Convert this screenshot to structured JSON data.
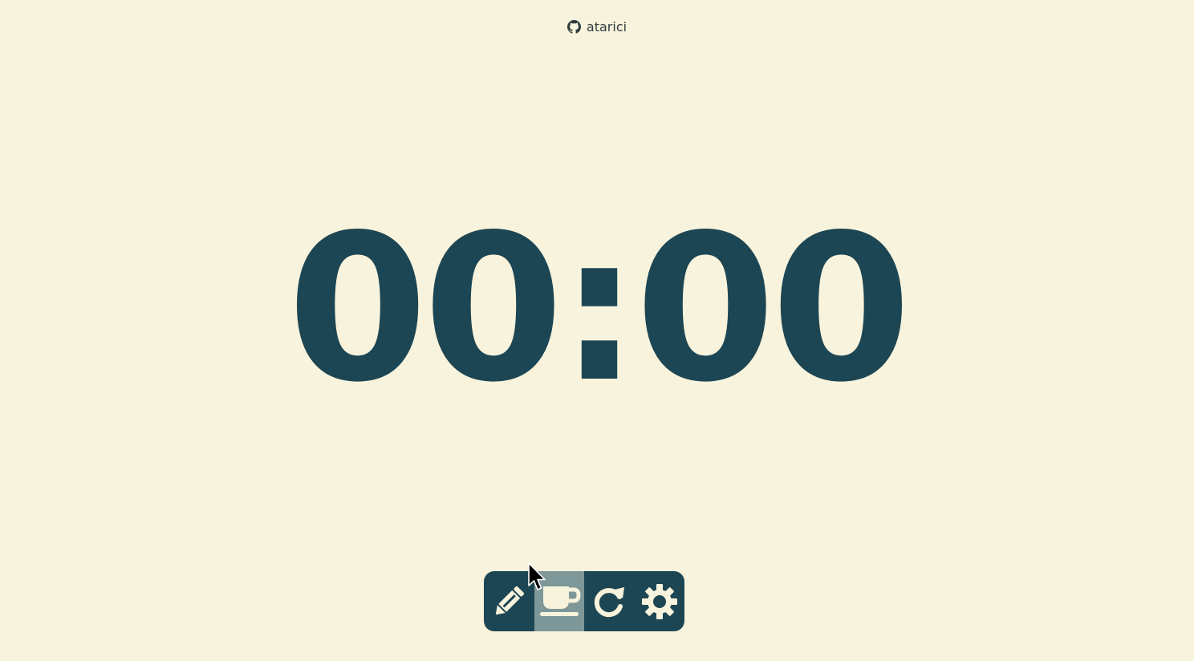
{
  "header": {
    "github_icon": "github-icon",
    "username": "atarici"
  },
  "timer": {
    "display": "00:00"
  },
  "toolbar": {
    "buttons": [
      {
        "icon": "pencil-icon",
        "active": false
      },
      {
        "icon": "coffee-cup-icon",
        "active": true
      },
      {
        "icon": "refresh-icon",
        "active": false
      },
      {
        "icon": "gear-icon",
        "active": false
      }
    ]
  },
  "colors": {
    "background": "#f8f3dc",
    "accent": "#1d4654",
    "active_button": "#7e9798",
    "icon": "#f8f3dc"
  }
}
